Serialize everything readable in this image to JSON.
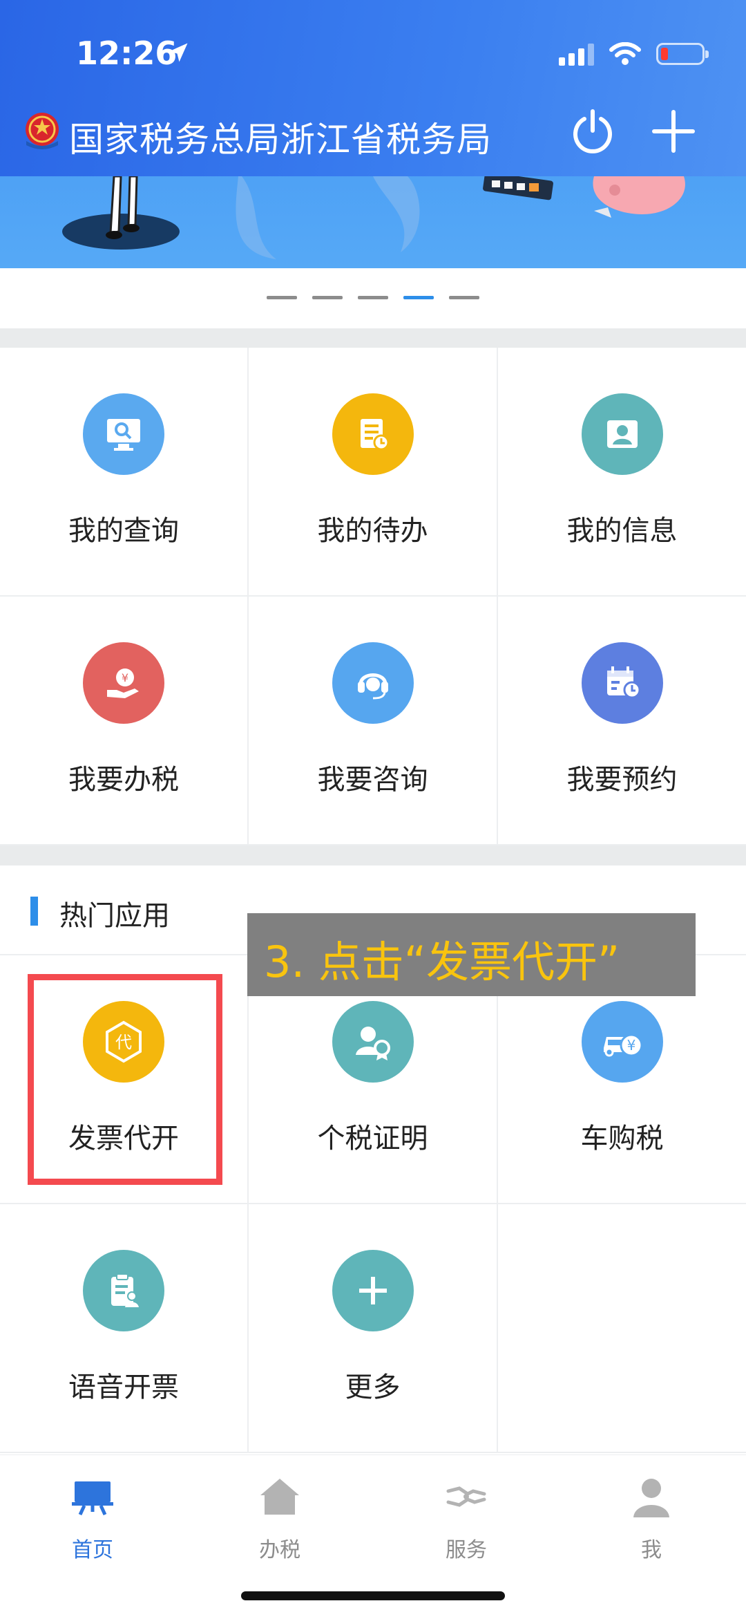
{
  "status_bar": {
    "time": "12:26"
  },
  "header": {
    "title": "国家税务总局浙江省税务局"
  },
  "colors": {
    "accent": "#2d8ee9",
    "header_blue": "#3b7ff0",
    "callout_text": "#f9c40e",
    "highlight_red": "#f44a4f"
  },
  "carousel": {
    "page_count": 5,
    "active_index": 4
  },
  "main_menu": [
    {
      "label": "我的查询",
      "icon": "monitor-search-icon",
      "color": "#5aa9ef"
    },
    {
      "label": "我的待办",
      "icon": "document-clock-icon",
      "color": "#f4b70d"
    },
    {
      "label": "我的信息",
      "icon": "person-icon",
      "color": "#5fb5b9"
    },
    {
      "label": "我要办税",
      "icon": "tax-hand-icon",
      "color": "#e2625f"
    },
    {
      "label": "我要咨询",
      "icon": "headset-icon",
      "color": "#56a6ef"
    },
    {
      "label": "我要预约",
      "icon": "calendar-clock-icon",
      "color": "#5d7fe0"
    }
  ],
  "hot_apps": {
    "title": "热门应用",
    "items": [
      {
        "label": "发票代开",
        "icon": "invoice-dai-icon",
        "icon_text": "代",
        "color": "#f4b70d"
      },
      {
        "label": "个税证明",
        "icon": "certificate-person-icon",
        "color": "#5fb5b9"
      },
      {
        "label": "车购税",
        "icon": "car-yuan-icon",
        "icon_text": "¥",
        "color": "#56a6ef"
      },
      {
        "label": "语音开票",
        "icon": "clipboard-person-icon",
        "color": "#5fb5b9"
      },
      {
        "label": "更多",
        "icon": "plus-icon",
        "color": "#5fb5b9"
      }
    ]
  },
  "callout": {
    "text": "3. 点击“发票代开”"
  },
  "tabs": [
    {
      "label": "首页",
      "icon": "home-board-icon",
      "active": true
    },
    {
      "label": "办税",
      "icon": "house-icon",
      "active": false
    },
    {
      "label": "服务",
      "icon": "handshake-icon",
      "active": false
    },
    {
      "label": "我",
      "icon": "user-icon",
      "active": false
    }
  ]
}
